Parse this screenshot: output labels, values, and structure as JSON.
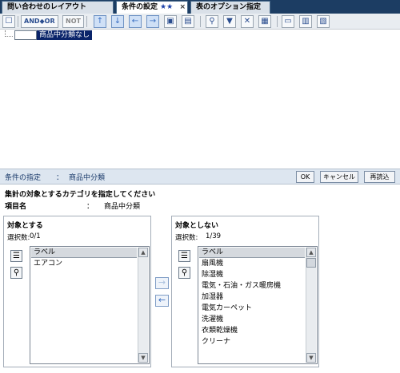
{
  "tabs": [
    {
      "label": "問い合わせのレイアウト",
      "stars": "",
      "close": ""
    },
    {
      "label": "条件の設定",
      "stars": "★★",
      "close": "×"
    },
    {
      "label": "表のオプション指定",
      "stars": "",
      "close": ""
    }
  ],
  "toolbar": {
    "and_or_label": "AND◆OR",
    "not_label": "NOT",
    "icons": [
      "select-all-icon",
      "and-or-icon",
      "not-icon",
      "move-up-icon",
      "move-down-icon",
      "move-left-icon",
      "move-right-icon",
      "new-condition-icon",
      "delete-condition-icon",
      "search-icon",
      "filter-icon",
      "clear-filter-icon",
      "properties-icon",
      "export-icon",
      "import-icon",
      "settings-icon"
    ]
  },
  "tree": {
    "node_label": "商品中分類なし"
  },
  "condition": {
    "title": "条件の指定",
    "separator": "：",
    "value": "商品中分類",
    "ok_label": "OK",
    "cancel_label": "キャンセル",
    "reload_label": "再読込"
  },
  "instruction": "集計の対象とするカテゴリを指定してください",
  "item_name": {
    "label": "項目名",
    "separator": "：",
    "value": "商品中分類"
  },
  "include_panel": {
    "title": "対象とする",
    "count_label": "選択数:",
    "count_value": "0/1",
    "header": "ラベル",
    "items": [
      "エアコン"
    ]
  },
  "exclude_panel": {
    "title": "対象としない",
    "count_label": "選択数:",
    "count_value": "1/39",
    "header": "ラベル",
    "items": [
      "扇風機",
      "除湿機",
      "電気・石油・ガス暖房機",
      "加湿器",
      "電気カーペット",
      "洗濯機",
      "衣類乾燥機",
      "クリーナ"
    ]
  },
  "move_buttons": {
    "right": "→",
    "left": "←"
  },
  "colors": {
    "tab_bar": "#1c3d63",
    "selection": "#0a246a",
    "condition_bar": "#dde6f0",
    "accent_star": "#1a3fa8"
  }
}
